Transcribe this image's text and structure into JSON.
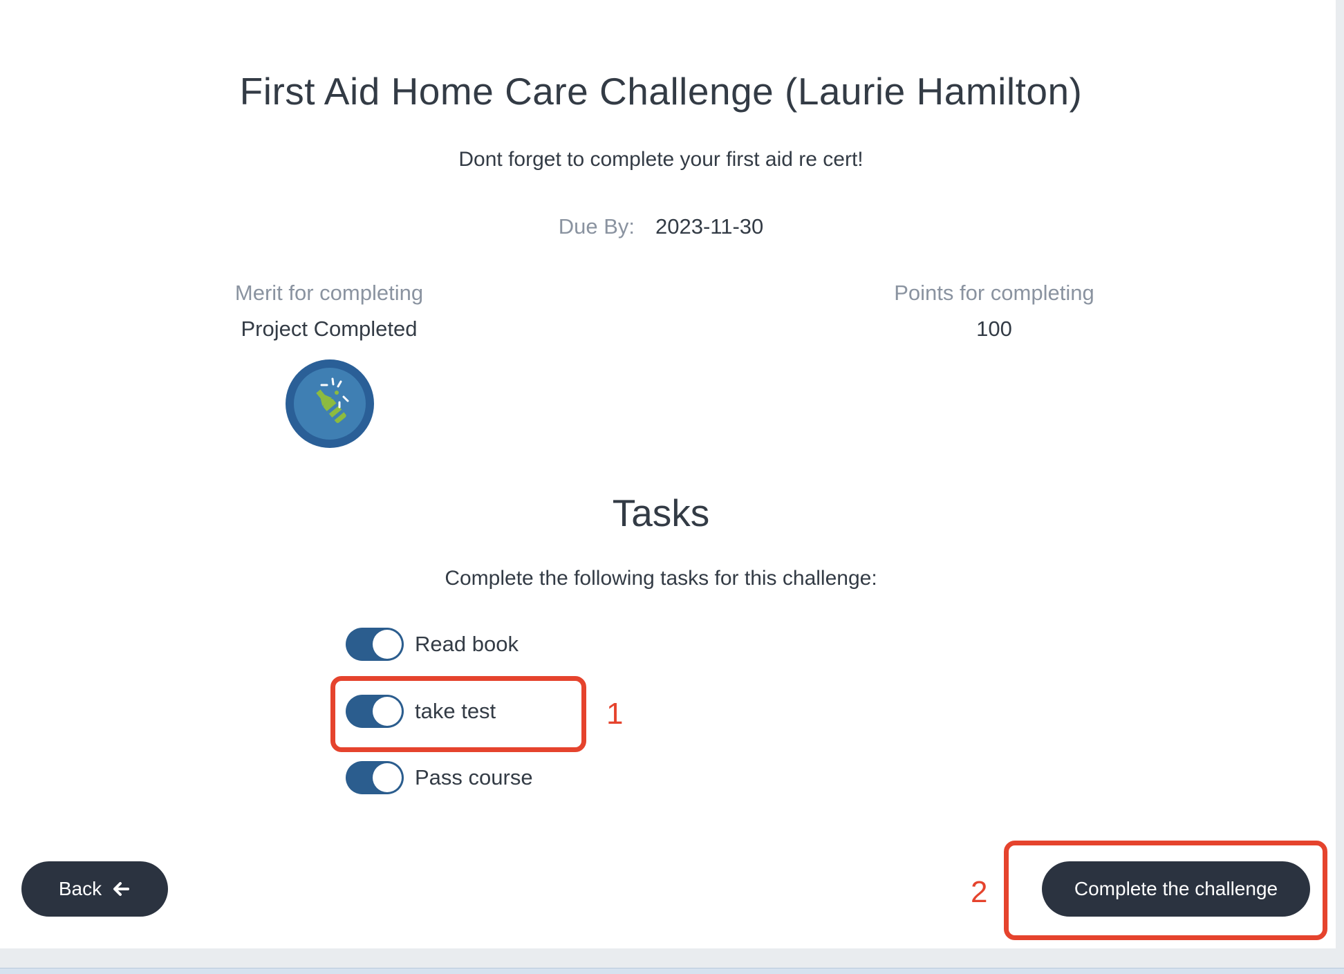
{
  "challenge": {
    "title": "First Aid Home Care Challenge (Laurie Hamilton)",
    "description": "Dont forget to complete your first aid re cert!",
    "due_label": "Due By:",
    "due_value": "2023-11-30"
  },
  "merit": {
    "label": "Merit for completing",
    "value": "Project Completed",
    "badge_icon": "champagne-bottle-icon"
  },
  "points": {
    "label": "Points for completing",
    "value": "100"
  },
  "tasks": {
    "heading": "Tasks",
    "intro": "Complete the following tasks for this challenge:",
    "items": [
      {
        "label": "Read book",
        "checked": true
      },
      {
        "label": "take test",
        "checked": true
      },
      {
        "label": "Pass course",
        "checked": true
      }
    ]
  },
  "annotations": {
    "step1": "1",
    "step2": "2",
    "color": "#e5432d"
  },
  "buttons": {
    "back": "Back",
    "back_icon": "arrow-left-icon",
    "complete": "Complete the challenge"
  },
  "colors": {
    "primary_dark": "#2b3340",
    "toggle_on": "#2b5d8e",
    "badge_outer": "#2a5f97",
    "badge_inner": "#3f7fb3"
  }
}
